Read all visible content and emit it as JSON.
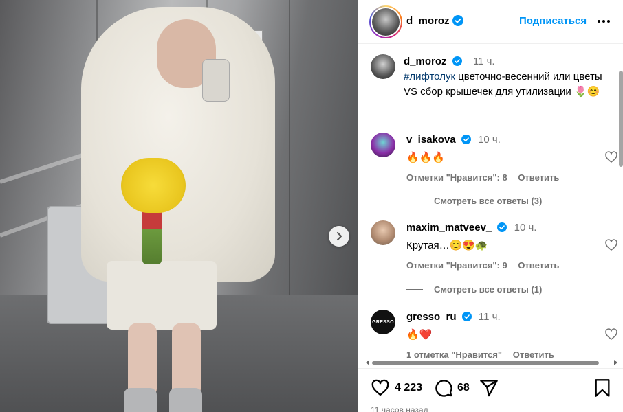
{
  "photo": {
    "next_icon": "chevron-right-icon"
  },
  "header": {
    "username": "d_moroz",
    "follow_label": "Подписаться",
    "more_icon": "more-horizontal-icon"
  },
  "caption": {
    "username": "d_moroz",
    "time": "11 ч.",
    "hashtag": "#лифтолук",
    "text": " цветочно-весенний или цветы VS сбор крышечек для утилизации 🌷😊"
  },
  "comments": [
    {
      "username": "v_isakova",
      "time": "10 ч.",
      "text": "🔥🔥🔥",
      "likes": "Отметки \"Нравится\": 8",
      "reply": "Ответить",
      "view_replies": "Смотреть все ответы (3)"
    },
    {
      "username": "maxim_matveev_",
      "time": "10 ч.",
      "text": "Крутая…😊😍🐢",
      "likes": "Отметки \"Нравится\": 9",
      "reply": "Ответить",
      "view_replies": "Смотреть все ответы (1)"
    },
    {
      "username": "gresso_ru",
      "time": "11 ч.",
      "text": "🔥❤️",
      "likes": "1 отметка \"Нравится\"",
      "reply": "Ответить",
      "avatar_text": "GRESSO"
    }
  ],
  "actions": {
    "likes_count": "4 223",
    "comments_count": "68",
    "like_icon": "heart-icon",
    "comment_icon": "comment-icon",
    "share_icon": "share-icon",
    "save_icon": "bookmark-icon"
  },
  "posted": "11 часов назад",
  "colors": {
    "link_blue": "#0095f6",
    "verified_blue": "#0095f6",
    "muted": "#737373",
    "heart_red": "#ff3040"
  }
}
